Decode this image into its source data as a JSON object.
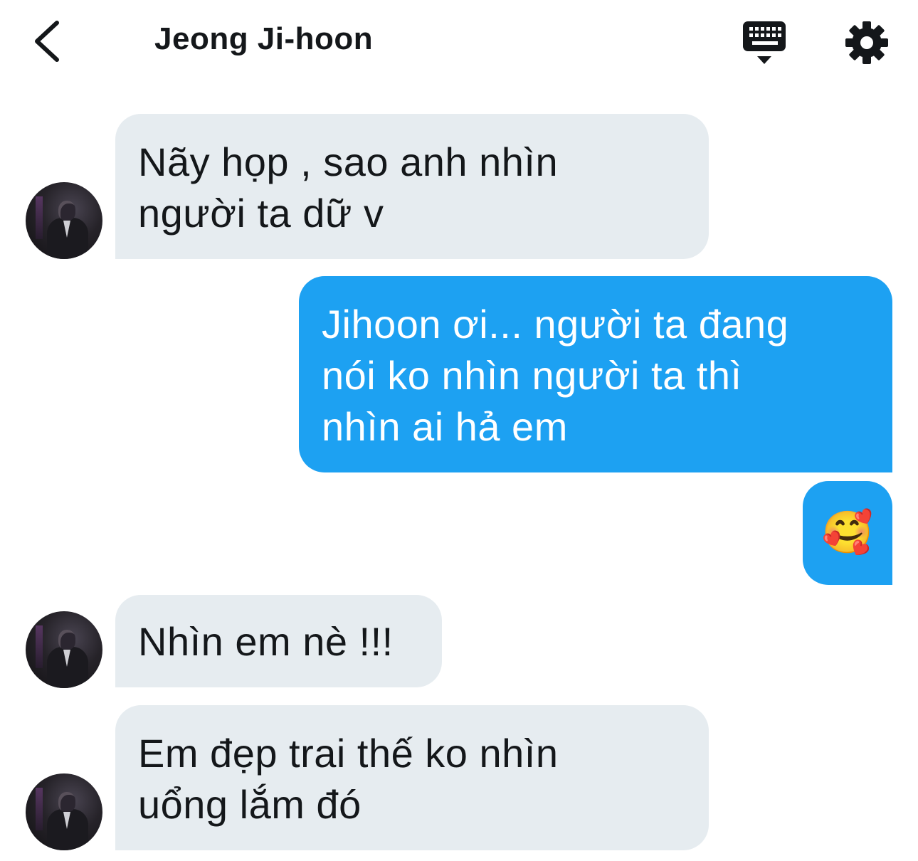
{
  "header": {
    "title": "Jeong Ji-hoon",
    "back_icon": "chevron-left-icon",
    "keyboard_icon": "keyboard-icon",
    "settings_icon": "gear-icon"
  },
  "colors": {
    "incoming_bubble": "#e6ecf0",
    "outgoing_bubble": "#1da1f2",
    "text_dark": "#14171a",
    "text_light": "#ffffff"
  },
  "messages": [
    {
      "direction": "incoming",
      "lines": [
        "Nãy họp , sao anh nhìn",
        "người ta dữ v"
      ]
    },
    {
      "direction": "outgoing",
      "lines": [
        "Jihoon ơi... người ta đang",
        "nói ko nhìn người ta thì",
        "nhìn ai hả em"
      ]
    },
    {
      "direction": "outgoing",
      "emoji": "🥰"
    },
    {
      "direction": "incoming",
      "lines": [
        "Nhìn em nè !!!"
      ]
    },
    {
      "direction": "incoming",
      "lines": [
        "Em đẹp trai thế ko nhìn",
        "uổng lắm đó"
      ]
    }
  ]
}
